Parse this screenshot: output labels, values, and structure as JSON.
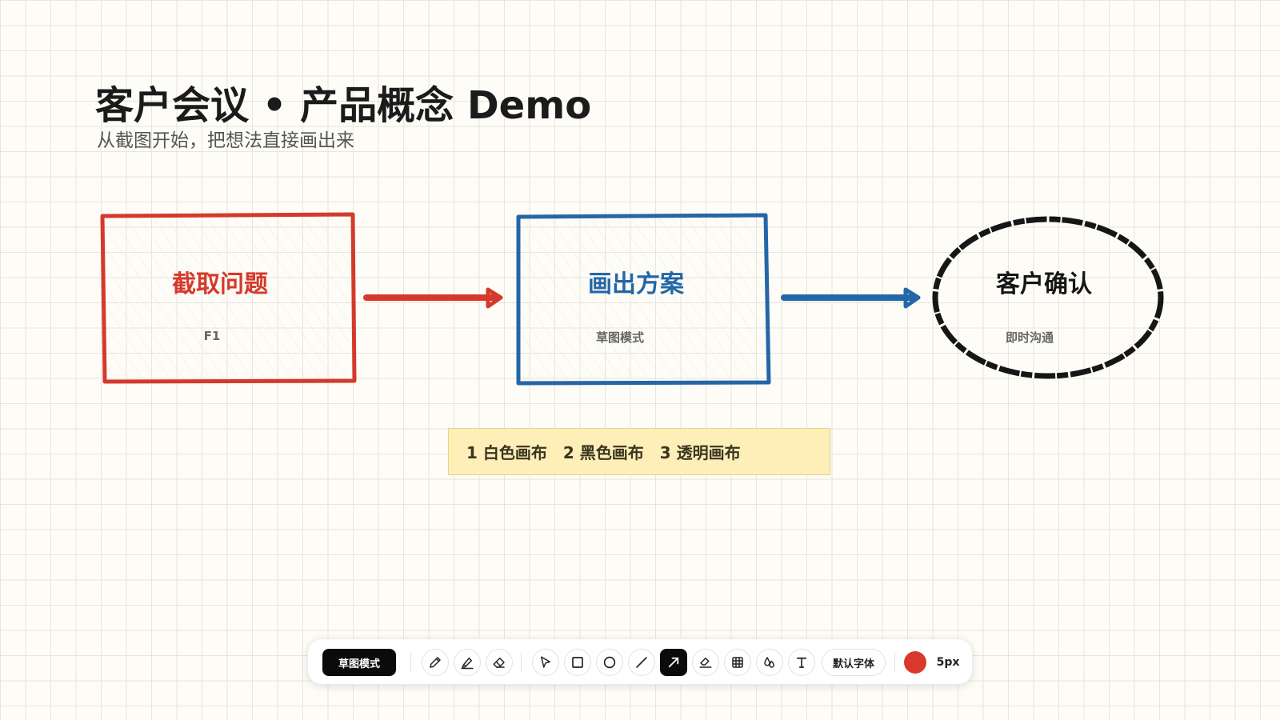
{
  "page": {
    "title": "客户会议 • 产品概念 Demo",
    "subtitle": "从截图开始，把想法直接画出来"
  },
  "flow": [
    {
      "label": "截取问题",
      "sub": "F1",
      "color": "#d33a2c",
      "shape": "rectangle"
    },
    {
      "label": "画出方案",
      "sub": "草图模式",
      "color": "#2466a8",
      "shape": "rectangle"
    },
    {
      "label": "客户确认",
      "sub": "即时沟通",
      "color": "#161616",
      "shape": "ellipse"
    }
  ],
  "arrows": [
    {
      "from": 0,
      "to": 1,
      "color": "#d33a2c"
    },
    {
      "from": 1,
      "to": 2,
      "color": "#2466a8"
    }
  ],
  "note": {
    "items": [
      "1 白色画布",
      "2 黑色画布",
      "3 透明画布"
    ],
    "background": "#fdefb7"
  },
  "toolbar": {
    "mode_label": "草图模式",
    "tools": [
      {
        "name": "pencil-icon",
        "active": false
      },
      {
        "name": "highlighter-icon",
        "active": false
      },
      {
        "name": "eraser-icon",
        "active": false
      },
      {
        "name": "select-cursor-icon",
        "active": false
      },
      {
        "name": "rectangle-icon",
        "active": false
      },
      {
        "name": "circle-icon",
        "active": false
      },
      {
        "name": "line-icon",
        "active": false
      },
      {
        "name": "arrow-icon",
        "active": true
      },
      {
        "name": "fill-eraser-icon",
        "active": false
      },
      {
        "name": "grid-icon",
        "active": false
      },
      {
        "name": "color-drops-icon",
        "active": false
      },
      {
        "name": "text-icon",
        "active": false
      }
    ],
    "font_label": "默认字体",
    "current_color": "#d8392b",
    "stroke_size": "5px"
  }
}
